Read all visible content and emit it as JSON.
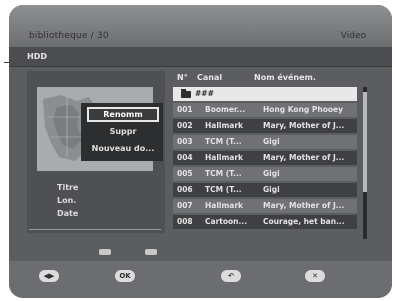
{
  "window": {
    "title": "bibliotheque / 30",
    "mode": "Video"
  },
  "subheader": {
    "label": "HDD"
  },
  "context_menu": {
    "items": [
      "Renomm",
      "Suppr",
      "Nouveau do..."
    ],
    "selected_index": 0
  },
  "info": {
    "labels": [
      "Titre",
      "Lon.",
      "Date"
    ]
  },
  "list": {
    "headers": {
      "num": "N°",
      "channel": "Canal",
      "event": "Nom événem."
    },
    "folder_label": "###",
    "rows": [
      {
        "num": "001",
        "channel": "Boomer...",
        "event": "Hong Kong Phooey"
      },
      {
        "num": "002",
        "channel": "Hallmark",
        "event": "Mary, Mother of J..."
      },
      {
        "num": "003",
        "channel": "TCM (T...",
        "event": "Gigi"
      },
      {
        "num": "004",
        "channel": "Hallmark",
        "event": "Mary, Mother of J..."
      },
      {
        "num": "005",
        "channel": "TCM (T...",
        "event": "Gigi"
      },
      {
        "num": "006",
        "channel": "TCM (T...",
        "event": "Gigi"
      },
      {
        "num": "007",
        "channel": "Hallmark",
        "event": "Mary, Mother of J..."
      },
      {
        "num": "008",
        "channel": "Cartoon...",
        "event": "Courage, het ban..."
      }
    ],
    "scroll_position": 0.1
  },
  "colors": {
    "row_dark": "#3f4043",
    "row_light": "#6f7174",
    "folder_row": "#e8e8e8"
  }
}
